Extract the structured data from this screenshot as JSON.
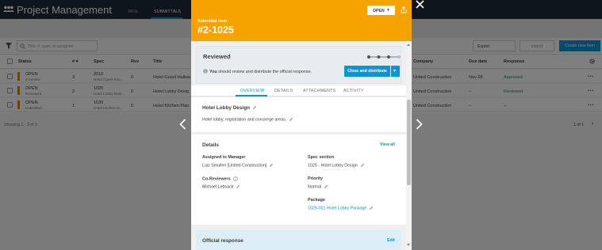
{
  "app": {
    "title": "Project Management",
    "nav_tabs": [
      "RFIs",
      "SUBMITTALS"
    ],
    "search_placeholder": "Title, #, spec or assignee",
    "toolbar": {
      "export": "Export",
      "import": "Import",
      "new_item": "Create new item"
    },
    "columns": [
      "Status",
      "# ▾",
      "Spec",
      "Rev",
      "Title",
      "Company",
      "Due date",
      "Response"
    ],
    "rows": [
      {
        "status": "OPEN",
        "substatus": "In review",
        "num": "3",
        "spec": "2010",
        "spec_sub": "Hotel Guest Roo...",
        "rev": "0",
        "title": "Hotel Guest Hallwa",
        "company": "United Construction",
        "due": "Nov 28",
        "response": "Approved"
      },
      {
        "status": "OPEN",
        "substatus": "Reviewed",
        "num": "2",
        "spec": "1025",
        "spec_sub": "Hotel Lobby Desi...",
        "rev": "0",
        "title": "Hotel Lobby Desig",
        "company": "United Construction",
        "due": "–",
        "response": "Reviewed"
      },
      {
        "status": "OPEN",
        "substatus": "Submitted",
        "num": "1",
        "spec": "1030",
        "spec_sub": "Hotel Kitchen Ar...",
        "rev": "0",
        "title": "Hotel Kitchen Plan",
        "company": "United Construction",
        "due": "–",
        "response": "–"
      }
    ],
    "footer": "Showing 1 - 3 of 3",
    "pagination": "1 of 1",
    "colors": {
      "topbar": "#1f2b38",
      "status_bar": "#d98b00",
      "approved": "#2e8b57",
      "reviewed": "#2e8b57"
    }
  },
  "modal": {
    "subtitle": "Submittal item",
    "title": "#2-1025",
    "status_dropdown": "OPEN",
    "header_color": "#f6a300",
    "workflow": {
      "state": "Reviewed",
      "message_bold": "You",
      "message_rest": " should review and distribute the official response.",
      "primary_button": "Close and distribute"
    },
    "tabs": [
      "OVERVIEW",
      "DETAILS",
      "ATTACHMENTS",
      "ACTIVITY"
    ],
    "active_tab": "OVERVIEW",
    "overview": {
      "name": "Hotel Lobby Design",
      "description": "Hotel lobby, registration and concierge areas."
    },
    "details": {
      "heading": "Details",
      "view_all": "View all",
      "assigned_label": "Assigned to Manager",
      "assigned_value": "Luiz Smullen [United Construction]",
      "coreviewers_label": "Co-Reviewers",
      "coreviewers_value": "Michael Lebsack",
      "spec_label": "Spec section",
      "spec_value": "1025 - Hotel Lobby Design",
      "priority_label": "Priority",
      "priority_value": "Normal",
      "package_label": "Package",
      "package_value": "1025-001 Hotel Lobby Package"
    },
    "official_response": {
      "heading": "Official response",
      "edit": "Edit"
    }
  }
}
